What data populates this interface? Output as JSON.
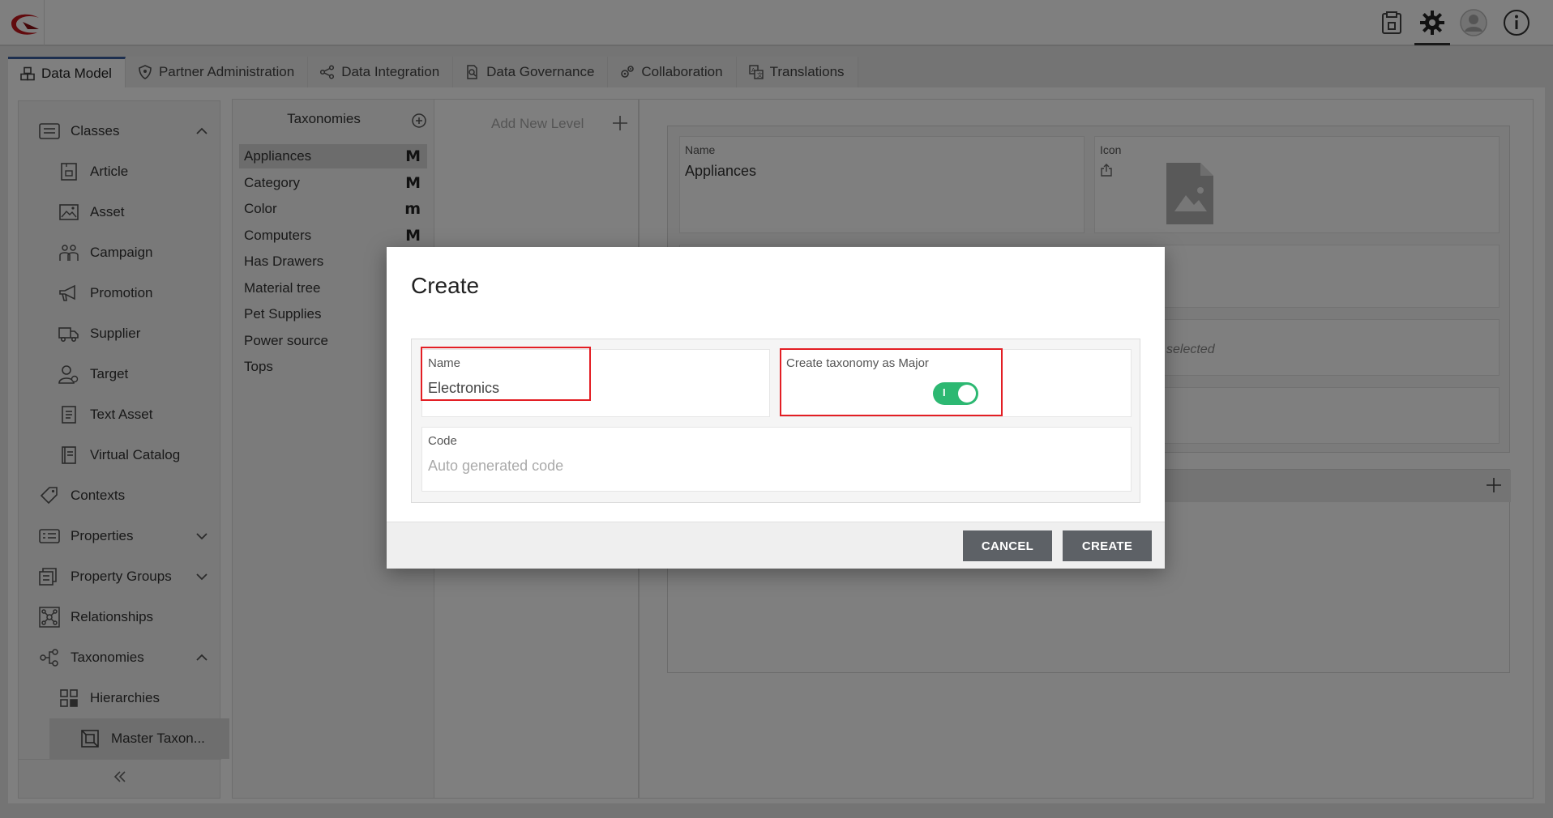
{
  "topbar": {
    "icons": [
      "logo-icon",
      "clipboard-icon",
      "gear-icon",
      "user-avatar-icon",
      "info-icon"
    ]
  },
  "tabs": [
    {
      "label": "Data Model",
      "icon": "cubes-icon",
      "active": true
    },
    {
      "label": "Partner Administration",
      "icon": "shield-icon",
      "active": false
    },
    {
      "label": "Data Integration",
      "icon": "share-nodes-icon",
      "active": false
    },
    {
      "label": "Data Governance",
      "icon": "document-search-icon",
      "active": false
    },
    {
      "label": "Collaboration",
      "icon": "gears-icon",
      "active": false
    },
    {
      "label": "Translations",
      "icon": "translate-icon",
      "active": false
    }
  ],
  "sidebar": {
    "items": [
      {
        "label": "Classes"
      },
      {
        "label": "Article"
      },
      {
        "label": "Asset"
      },
      {
        "label": "Campaign"
      },
      {
        "label": "Promotion"
      },
      {
        "label": "Supplier"
      },
      {
        "label": "Target"
      },
      {
        "label": "Text Asset"
      },
      {
        "label": "Virtual Catalog"
      },
      {
        "label": "Contexts"
      },
      {
        "label": "Properties"
      },
      {
        "label": "Property Groups"
      },
      {
        "label": "Relationships"
      },
      {
        "label": "Taxonomies"
      },
      {
        "label": "Hierarchies"
      },
      {
        "label": "Master Taxon..."
      }
    ]
  },
  "taxonomies": {
    "title": "Taxonomies",
    "items": [
      {
        "label": "Appliances",
        "badge": "M"
      },
      {
        "label": "Category",
        "badge": "M"
      },
      {
        "label": "Color",
        "badge": "m"
      },
      {
        "label": "Computers",
        "badge": "M"
      },
      {
        "label": "Has Drawers",
        "badge": ""
      },
      {
        "label": "Material tree",
        "badge": ""
      },
      {
        "label": "Pet Supplies",
        "badge": ""
      },
      {
        "label": "Power source",
        "badge": ""
      },
      {
        "label": "Tops",
        "badge": ""
      }
    ]
  },
  "levels": {
    "add_label": "Add New Level"
  },
  "details": {
    "name_label": "Name",
    "name_value": "Appliances",
    "icon_label": "Icon",
    "partial_text": "selected"
  },
  "modal": {
    "title": "Create",
    "name_label": "Name",
    "name_value": "Electronics",
    "major_label": "Create taxonomy as Major",
    "major_toggle_on": true,
    "toggle_mark": "I",
    "code_label": "Code",
    "code_placeholder": "Auto generated code",
    "cancel_label": "CANCEL",
    "create_label": "CREATE",
    "highlight_color": "#e31e24",
    "toggle_color": "#2db872"
  }
}
